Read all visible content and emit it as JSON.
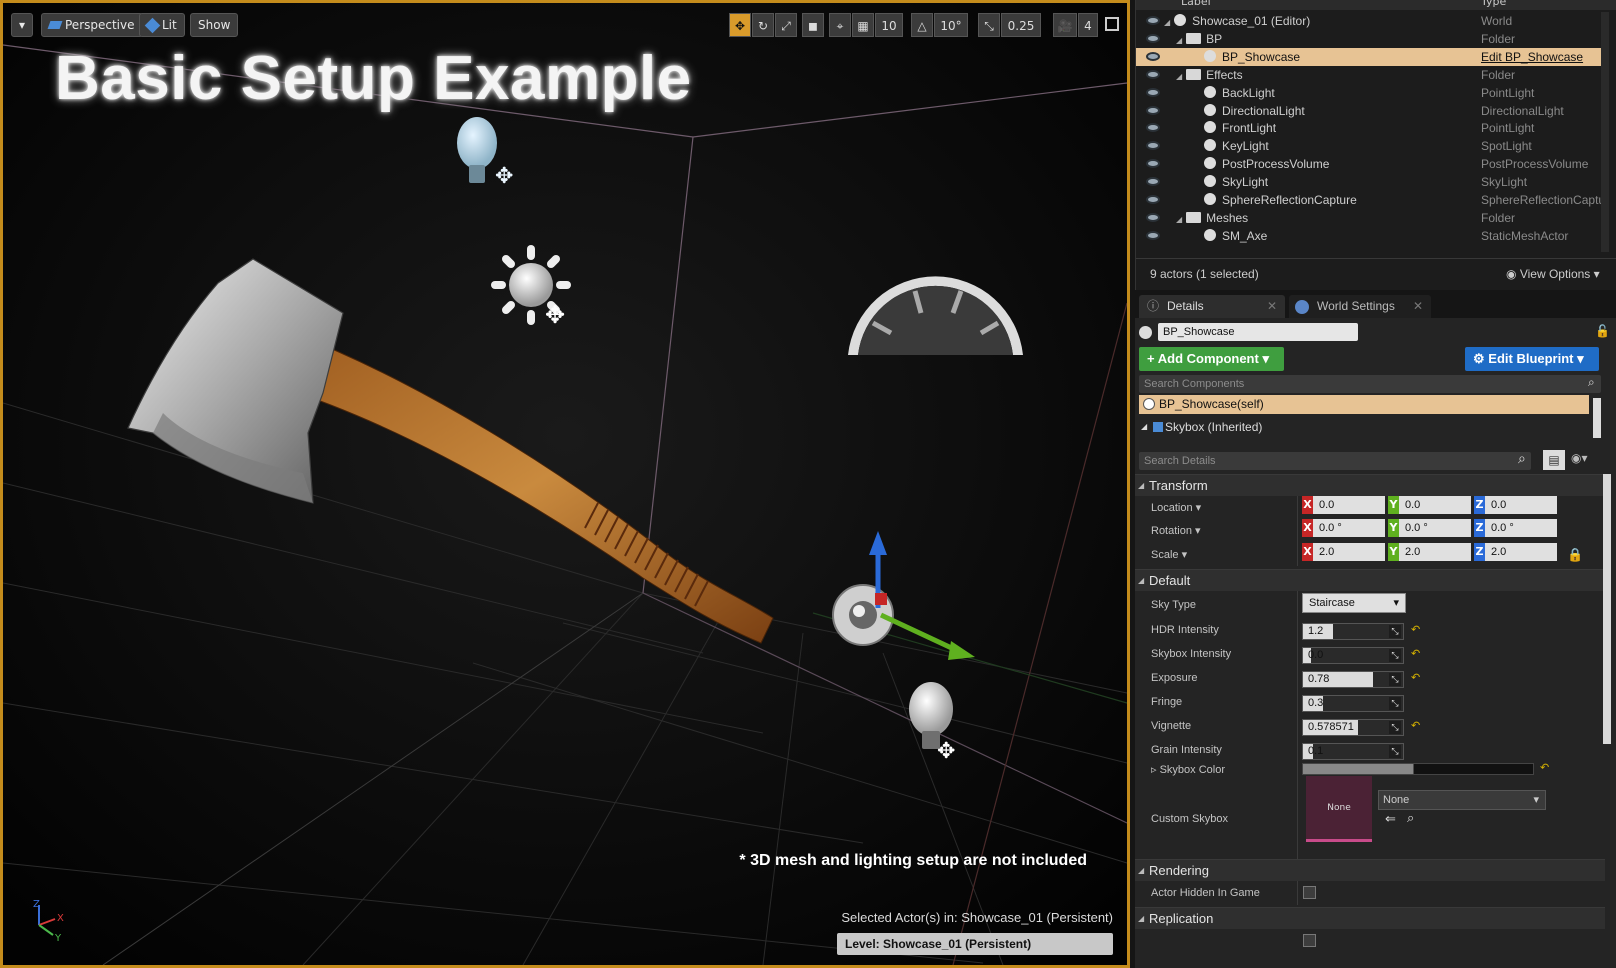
{
  "viewport": {
    "toolbar": {
      "menu_icon": "chevron-down-icon",
      "perspective": "Perspective",
      "lit": "Lit",
      "show": "Show",
      "grid_snap": "10",
      "rotation_snap": "10°",
      "scale_snap": "0.25",
      "camera_speed": "4"
    },
    "overlay_title": "Basic Setup Example",
    "note": "* 3D mesh and lighting setup are not included",
    "selected_actors": "Selected Actor(s) in:  Showcase_01 (Persistent)",
    "level": "Level:  Showcase_01 (Persistent)",
    "axes": {
      "x": "X",
      "y": "Y",
      "z": "Z"
    }
  },
  "outliner": {
    "col_label": "Label",
    "col_type": "Type",
    "rows": [
      {
        "label": "Showcase_01 (Editor)",
        "type": "World",
        "indent": 0
      },
      {
        "label": "BP",
        "type": "Folder",
        "indent": 1
      },
      {
        "label": "BP_Showcase",
        "type": "Edit BP_Showcase",
        "indent": 2,
        "selected": true
      },
      {
        "label": "Effects",
        "type": "Folder",
        "indent": 1
      },
      {
        "label": "BackLight",
        "type": "PointLight",
        "indent": 2
      },
      {
        "label": "DirectionalLight",
        "type": "DirectionalLight",
        "indent": 2
      },
      {
        "label": "FrontLight",
        "type": "PointLight",
        "indent": 2
      },
      {
        "label": "KeyLight",
        "type": "SpotLight",
        "indent": 2
      },
      {
        "label": "PostProcessVolume",
        "type": "PostProcessVolume",
        "indent": 2
      },
      {
        "label": "SkyLight",
        "type": "SkyLight",
        "indent": 2
      },
      {
        "label": "SphereReflectionCapture",
        "type": "SphereReflectionCaptur",
        "indent": 2
      },
      {
        "label": "Meshes",
        "type": "Folder",
        "indent": 1
      },
      {
        "label": "SM_Axe",
        "type": "StaticMeshActor",
        "indent": 2
      }
    ],
    "actor_count": "9 actors (1 selected)",
    "view_options": "View Options"
  },
  "tabs": {
    "details": "Details",
    "world_settings": "World Settings"
  },
  "details": {
    "actor_name": "BP_Showcase",
    "add_component": "Add Component",
    "edit_blueprint": "Edit Blueprint",
    "search_components_placeholder": "Search Components",
    "component_self": "BP_Showcase(self)",
    "component_inherited": "Skybox (Inherited)",
    "search_details_placeholder": "Search Details",
    "transform": {
      "title": "Transform",
      "location_label": "Location",
      "rotation_label": "Rotation",
      "scale_label": "Scale",
      "location": [
        "0.0",
        "0.0",
        "0.0"
      ],
      "rotation": [
        "0.0 °",
        "0.0 °",
        "0.0 °"
      ],
      "scale": [
        "2.0",
        "2.0",
        "2.0"
      ]
    },
    "default": {
      "title": "Default",
      "sky_type_label": "Sky Type",
      "sky_type": "Staircase",
      "hdr_label": "HDR Intensity",
      "hdr": "1.2",
      "skybox_intensity_label": "Skybox Intensity",
      "skybox_intensity": "0.0",
      "exposure_label": "Exposure",
      "exposure": "0.78",
      "fringe_label": "Fringe",
      "fringe": "0.3",
      "vignette_label": "Vignette",
      "vignette": "0.578571",
      "grain_label": "Grain Intensity",
      "grain": "0.1",
      "skybox_color_label": "Skybox Color",
      "custom_skybox_label": "Custom Skybox",
      "custom_skybox_thumb": "None",
      "custom_skybox_value": "None"
    },
    "rendering": {
      "title": "Rendering",
      "actor_hidden_label": "Actor Hidden In Game"
    },
    "replication": {
      "title": "Replication"
    }
  },
  "colors": {
    "selection_border": "#c48c1c",
    "selected_row": "#e7c394",
    "add_component": "#3f9e3f",
    "edit_blueprint": "#1f6cc6"
  }
}
